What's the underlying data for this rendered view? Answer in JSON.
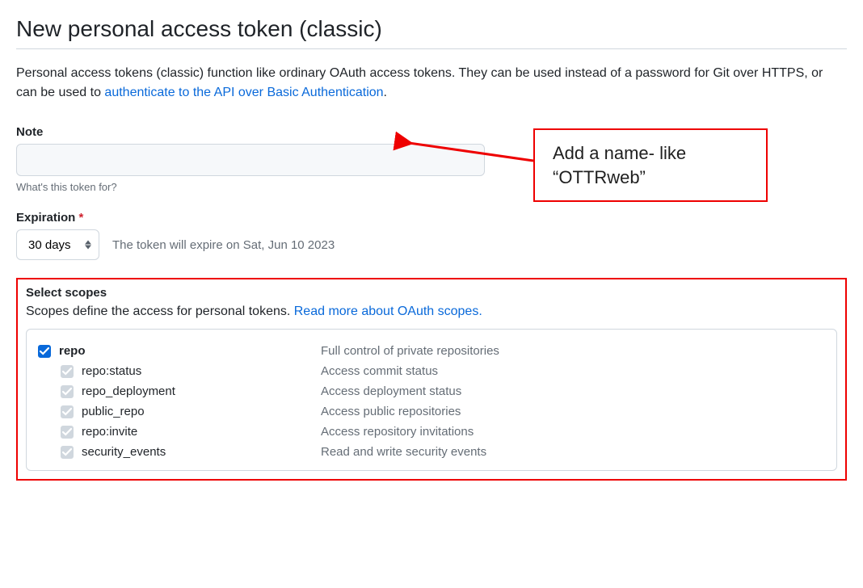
{
  "header": {
    "title": "New personal access token (classic)"
  },
  "intro": {
    "text_before": "Personal access tokens (classic) function like ordinary OAuth access tokens. They can be used instead of a password for Git over HTTPS, or can be used to ",
    "link_text": "authenticate to the API over Basic Authentication",
    "text_after": "."
  },
  "note": {
    "label": "Note",
    "value": "",
    "hint": "What's this token for?"
  },
  "expiration": {
    "label": "Expiration",
    "required_marker": "*",
    "selected": "30 days",
    "expiry_text": "The token will expire on Sat, Jun 10 2023"
  },
  "scopes": {
    "title": "Select scopes",
    "desc_before": "Scopes define the access for personal tokens. ",
    "link_text": "Read more about OAuth scopes.",
    "items": [
      {
        "name": "repo",
        "desc": "Full control of private repositories",
        "checked": true,
        "bold": true,
        "child": false
      },
      {
        "name": "repo:status",
        "desc": "Access commit status",
        "checked": false,
        "bold": false,
        "child": true
      },
      {
        "name": "repo_deployment",
        "desc": "Access deployment status",
        "checked": false,
        "bold": false,
        "child": true
      },
      {
        "name": "public_repo",
        "desc": "Access public repositories",
        "checked": false,
        "bold": false,
        "child": true
      },
      {
        "name": "repo:invite",
        "desc": "Access repository invitations",
        "checked": false,
        "bold": false,
        "child": true
      },
      {
        "name": "security_events",
        "desc": "Read and write security events",
        "checked": false,
        "bold": false,
        "child": true
      }
    ]
  },
  "annotation": {
    "line1": "Add a name- like",
    "line2": "“OTTRweb”"
  }
}
